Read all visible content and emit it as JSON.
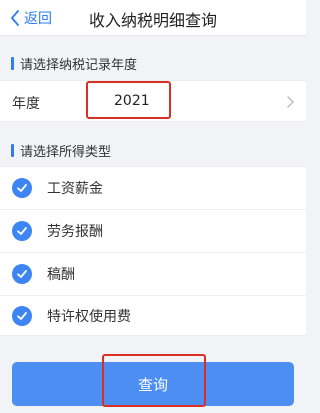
{
  "navbar": {
    "back_label": "返回",
    "title": "收入纳税明细查询"
  },
  "record_year_section": {
    "heading": "请选择纳税记录年度",
    "year_label": "年度",
    "year_value": "2021"
  },
  "income_type_section": {
    "heading": "请选择所得类型",
    "items": [
      {
        "label": "工资薪金",
        "checked": true
      },
      {
        "label": "劳务报酬",
        "checked": true
      },
      {
        "label": "稿酬",
        "checked": true
      },
      {
        "label": "特许权使用费",
        "checked": true
      }
    ]
  },
  "actions": {
    "query_label": "查询"
  },
  "colors": {
    "accent": "#2f7cf6",
    "checkbox": "#3d86f2",
    "button": "#4d8ef3",
    "highlight": "#d93025",
    "background": "#f2f3f7"
  },
  "icons": {
    "back": "chevron-left-icon",
    "year_picker": "chevron-right-icon",
    "checked": "check-circle-icon"
  }
}
